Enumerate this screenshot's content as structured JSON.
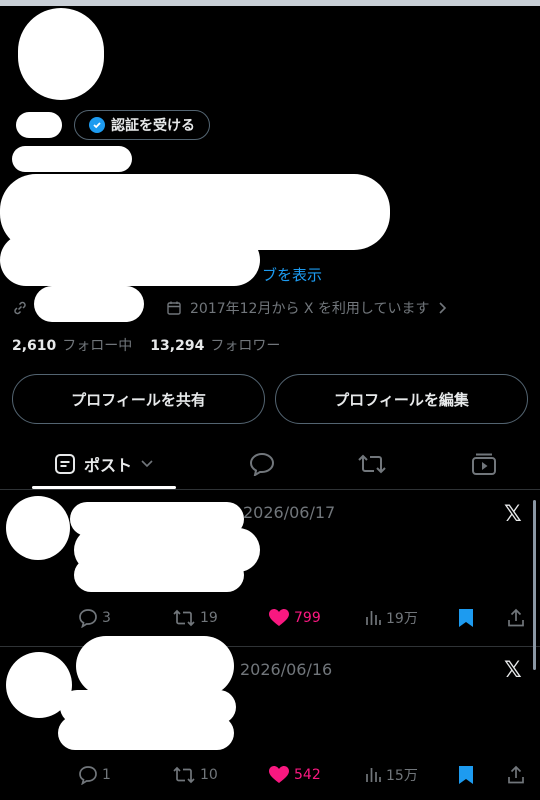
{
  "profile": {
    "verify_label": "認証を受ける",
    "bio_link_fragment": "ブを表示",
    "joined": "2017年12月から X を利用しています",
    "following_count": "2,610",
    "following_label": "フォロー中",
    "followers_count": "13,294",
    "followers_label": "フォロワー"
  },
  "buttons": {
    "share_profile": "プロフィールを共有",
    "edit_profile": "プロフィールを編集"
  },
  "tabs": {
    "posts_label": "ポスト"
  },
  "posts": [
    {
      "date": "2026/06/17",
      "replies": "3",
      "reposts": "19",
      "likes": "799",
      "views": "19万"
    },
    {
      "date": "2026/06/16",
      "replies": "1",
      "reposts": "10",
      "likes": "542",
      "views": "15万"
    }
  ],
  "colors": {
    "accent": "#1d9bf0",
    "like": "#f91880",
    "muted": "#71767b",
    "border": "#536471"
  },
  "icons": [
    "verified-badge-icon",
    "link-icon",
    "calendar-icon",
    "chevron-right-icon",
    "posts-icon",
    "chevron-down-icon",
    "reply-icon",
    "repost-icon",
    "media-icon",
    "x-logo-icon",
    "like-icon",
    "views-icon",
    "bookmark-icon",
    "share-icon"
  ]
}
